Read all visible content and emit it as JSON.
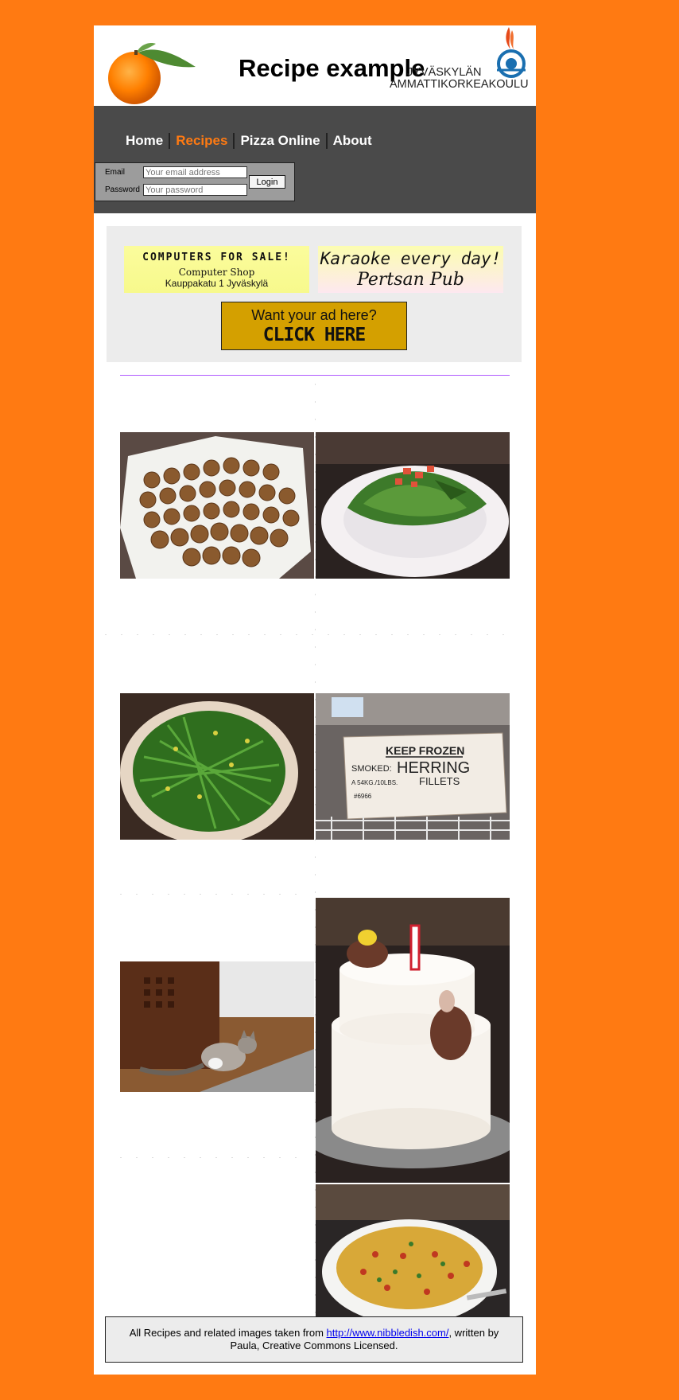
{
  "header": {
    "title": "Recipe example",
    "logo_line1": "JYVÄSKYLÄN",
    "logo_line2": "AMMATTIKORKEAKOULU"
  },
  "nav": {
    "items": [
      {
        "label": "Home",
        "active": false
      },
      {
        "label": "Recipes",
        "active": true
      },
      {
        "label": "Pizza Online",
        "active": false
      },
      {
        "label": "About",
        "active": false
      }
    ]
  },
  "login": {
    "email_label": "Email",
    "email_placeholder": "Your email address",
    "password_label": "Password",
    "password_placeholder": "Your password",
    "button_label": "Login"
  },
  "ads": {
    "computers": {
      "line1": "COMPUTERS FOR SALE!",
      "line2": "Computer Shop",
      "line3": "Kauppakatu 1 Jyväskylä"
    },
    "karaoke": {
      "line1": "Karaoke every day!",
      "line2": "Pertsan Pub"
    },
    "click": {
      "line1": "Want your ad here?",
      "line2": "CLICK HERE"
    }
  },
  "photos": {
    "herring_sign": {
      "line1": "KEEP FROZEN",
      "smoked": "SMOKED:",
      "herring": "HERRING",
      "fillets": "FILLETS",
      "weight": "A 54KG./10LBS.",
      "code": "#6966"
    }
  },
  "footer": {
    "text_before": "All Recipes and related images taken from ",
    "link": "http://www.nibbledish.com/",
    "text_after": ", written by Paula, Creative Commons Licensed."
  },
  "colors": {
    "background": "#FF7A12",
    "nav_bg": "#4a4a4a",
    "active_nav": "#FF7A12",
    "divider": "#b05bff"
  }
}
